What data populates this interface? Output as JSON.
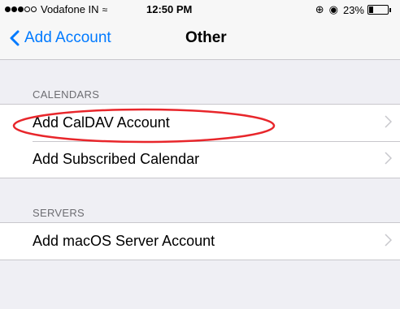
{
  "status_bar": {
    "carrier": "Vodafone IN",
    "time": "12:50 PM",
    "battery": "23%",
    "battery_level": 0.23,
    "signal_bars_filled": 3,
    "signal_bars_total": 5
  },
  "nav": {
    "back_label": "Add Account",
    "title": "Other"
  },
  "sections": {
    "calendars": {
      "header": "CALENDARS",
      "items": [
        {
          "label": "Add CalDAV Account"
        },
        {
          "label": "Add Subscribed Calendar"
        }
      ]
    },
    "servers": {
      "header": "SERVERS",
      "items": [
        {
          "label": "Add macOS Server Account"
        }
      ]
    }
  },
  "colors": {
    "accent": "#007aff",
    "highlight": "#e8262b",
    "background": "#efeff4"
  },
  "icons": {
    "back": "chevron-left-icon",
    "disclosure": "chevron-right-icon",
    "wifi": "wifi-icon",
    "alarm": "alarm-icon",
    "lock": "orientation-lock-icon",
    "battery": "battery-icon"
  }
}
